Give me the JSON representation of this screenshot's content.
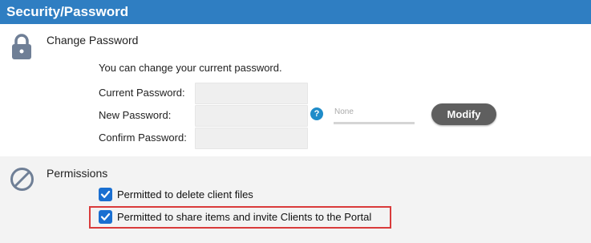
{
  "header": {
    "title": "Security/Password"
  },
  "change_password": {
    "title": "Change Password",
    "hint": "You can change your current password.",
    "fields": [
      {
        "label": "Current Password:",
        "value": ""
      },
      {
        "label": "New Password:",
        "value": ""
      },
      {
        "label": "Confirm Password:",
        "value": ""
      }
    ],
    "help_glyph": "?",
    "strength_label": "None",
    "modify_label": "Modify",
    "icon": "lock-icon"
  },
  "permissions": {
    "title": "Permissions",
    "icon": "ban-icon",
    "items": [
      {
        "label": "Permitted to delete client files",
        "checked": true
      },
      {
        "label": "Permitted to share items and invite Clients to the Portal",
        "checked": true
      }
    ]
  },
  "colors": {
    "header_bg": "#2f7ec2",
    "checkbox": "#1a6fd1",
    "highlight": "#d93b3b",
    "button": "#5f5f5f"
  }
}
